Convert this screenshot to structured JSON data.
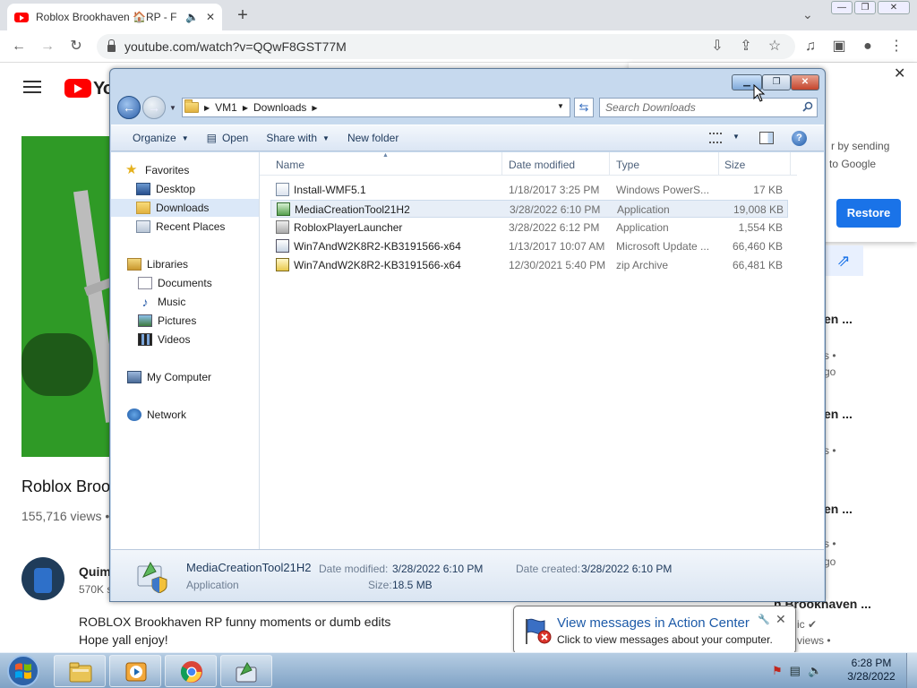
{
  "browser": {
    "tab_title": "Roblox Brookhaven 🏠RP - F",
    "tab_audio_icon": "speaker-icon",
    "tab_close": "✕",
    "new_tab": "+",
    "url": "youtube.com/watch?v=QQwF8GST77M",
    "window_controls": [
      "—",
      "❐",
      "✕"
    ]
  },
  "youtube": {
    "logo_text": "Yo",
    "video_title": "Roblox Broo",
    "views": "155,716 views •",
    "channel_name": "Quim",
    "channel_subs": "570K s",
    "description_line1": "ROBLOX Brookhaven RP funny moments or dumb edits",
    "description_line2": "Hope yall enjoy!",
    "popup": {
      "text1": "r by sending",
      "text2": "to Google",
      "restore_button": "Restore",
      "close": "✕"
    },
    "sidebar_titles": [
      "en ...",
      "en ...",
      "en ...",
      "n Brookhaven ..."
    ],
    "sidebar_subs": [
      "s •",
      "go",
      "s •",
      "s •",
      "go",
      "s •",
      "go",
      "ic ✔",
      "views •"
    ]
  },
  "explorer": {
    "breadcrumb": [
      "VM1",
      "Downloads"
    ],
    "search_placeholder": "Search Downloads",
    "commands": {
      "organize": "Organize",
      "open": "Open",
      "share_with": "Share with",
      "new_folder": "New folder"
    },
    "nav": {
      "favorites": "Favorites",
      "desktop": "Desktop",
      "downloads": "Downloads",
      "recent_places": "Recent Places",
      "libraries": "Libraries",
      "documents": "Documents",
      "music": "Music",
      "pictures": "Pictures",
      "videos": "Videos",
      "my_computer": "My Computer",
      "network": "Network"
    },
    "columns": {
      "name": "Name",
      "date_modified": "Date modified",
      "type": "Type",
      "size": "Size"
    },
    "files": [
      {
        "name": "Install-WMF5.1",
        "date": "1/18/2017 3:25 PM",
        "type": "Windows PowerS...",
        "size": "17 KB"
      },
      {
        "name": "MediaCreationTool21H2",
        "date": "3/28/2022 6:10 PM",
        "type": "Application",
        "size": "19,008 KB"
      },
      {
        "name": "RobloxPlayerLauncher",
        "date": "3/28/2022 6:12 PM",
        "type": "Application",
        "size": "1,554 KB"
      },
      {
        "name": "Win7AndW2K8R2-KB3191566-x64",
        "date": "1/13/2017 10:07 AM",
        "type": "Microsoft Update ...",
        "size": "66,460 KB"
      },
      {
        "name": "Win7AndW2K8R2-KB3191566-x64",
        "date": "12/30/2021 5:40 PM",
        "type": "zip Archive",
        "size": "66,481 KB"
      }
    ],
    "details": {
      "name": "MediaCreationTool21H2",
      "type": "Application",
      "date_modified_label": "Date modified:",
      "date_modified": "3/28/2022 6:10 PM",
      "size_label": "Size:",
      "size": "18.5 MB",
      "date_created_label": "Date created:",
      "date_created": "3/28/2022 6:10 PM"
    }
  },
  "balloon": {
    "title": "View messages in Action Center",
    "text": "Click to view messages about your computer.",
    "close": "✕"
  },
  "taskbar": {
    "time": "6:28 PM",
    "date": "3/28/2022"
  },
  "colors": {
    "youtube_red": "#ff0000",
    "restore_blue": "#1a73e8",
    "action_center_title": "#1c5aa8"
  }
}
